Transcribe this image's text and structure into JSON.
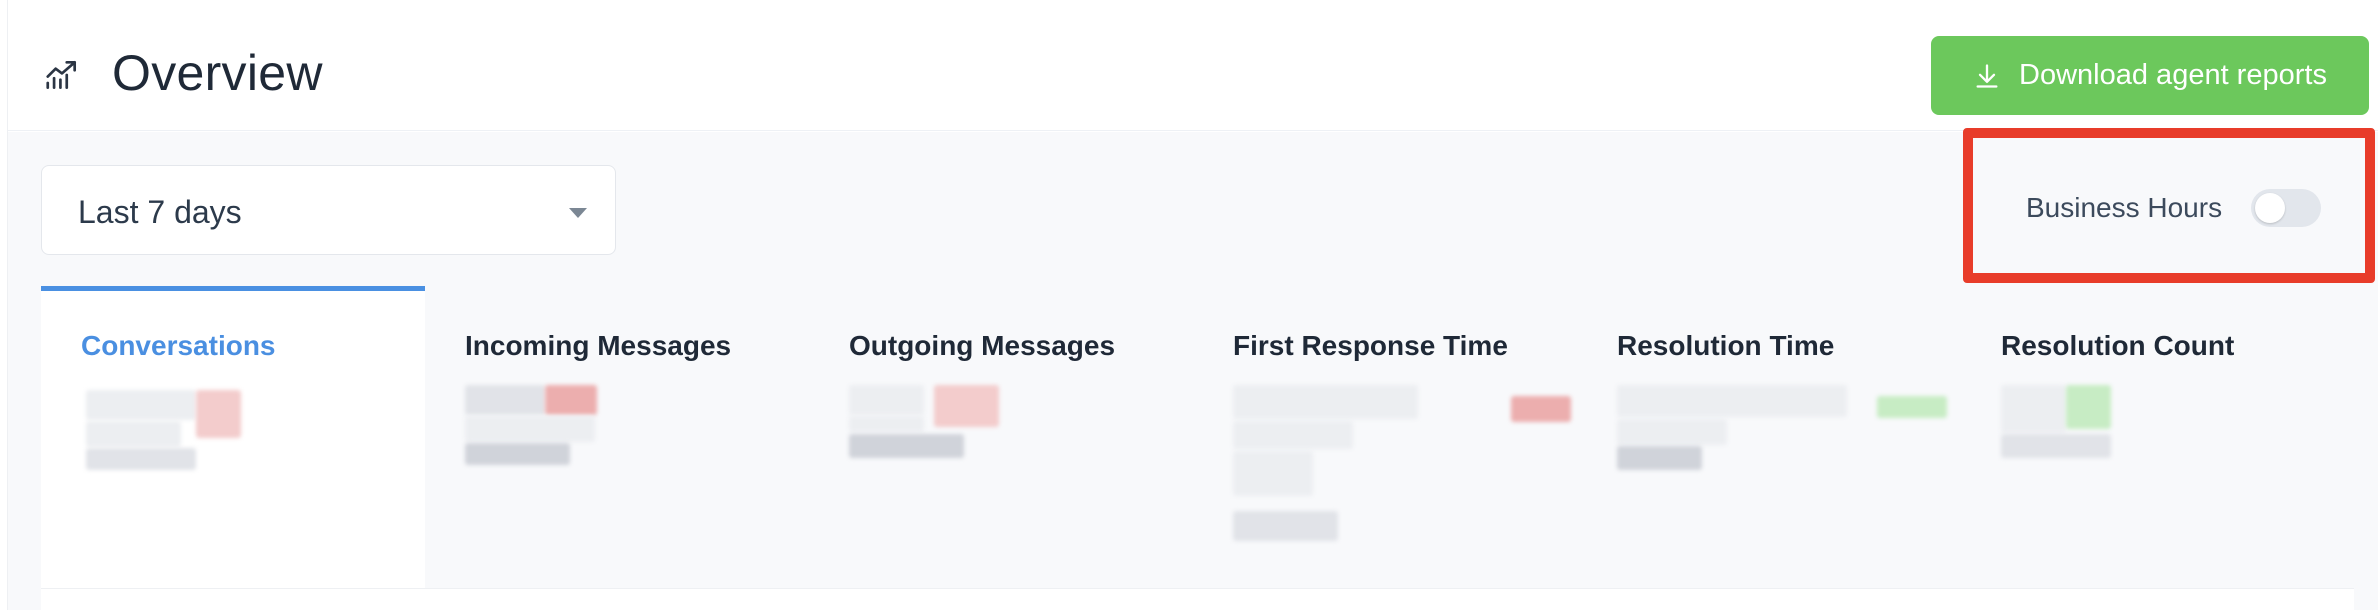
{
  "header": {
    "title": "Overview",
    "icon": "chart-trend-icon",
    "download_label": "Download agent reports",
    "download_icon": "download-icon",
    "download_color": "#6cc85c"
  },
  "filters": {
    "date_range": {
      "selected": "Last 7 days",
      "icon": "caret-down-icon"
    },
    "business_hours": {
      "label": "Business Hours",
      "enabled": false
    }
  },
  "tabs": [
    {
      "label": "Conversations",
      "active": true
    },
    {
      "label": "Incoming Messages",
      "active": false
    },
    {
      "label": "Outgoing Messages",
      "active": false
    },
    {
      "label": "First Response Time",
      "active": false
    },
    {
      "label": "Resolution Time",
      "active": false
    },
    {
      "label": "Resolution Count",
      "active": false
    }
  ],
  "colors": {
    "accent": "#4a8fe1",
    "highlight": "#e83c2a",
    "page_bg": "#f8f9fb"
  }
}
